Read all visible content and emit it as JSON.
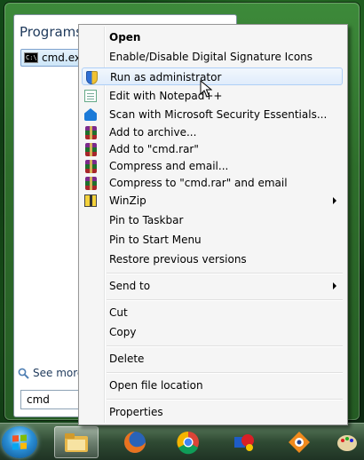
{
  "start_menu": {
    "programs_header": "Programs (",
    "result": {
      "label": "cmd.ex",
      "icon": "command-prompt-icon"
    },
    "see_more": "See more",
    "search_value": "cmd"
  },
  "context_menu": {
    "items": [
      {
        "label": "Open",
        "bold": true,
        "icon": ""
      },
      {
        "label": "Enable/Disable Digital Signature Icons",
        "icon": ""
      },
      {
        "label": "Run as administrator",
        "icon": "uac-shield-icon",
        "hover": true
      },
      {
        "label": "Edit with Notepad++",
        "icon": "notepad-plus-plus-icon"
      },
      {
        "label": "Scan with Microsoft Security Essentials...",
        "icon": "security-essentials-icon"
      },
      {
        "label": "Add to archive...",
        "icon": "winrar-icon"
      },
      {
        "label": "Add to \"cmd.rar\"",
        "icon": "winrar-icon"
      },
      {
        "label": "Compress and email...",
        "icon": "winrar-icon"
      },
      {
        "label": "Compress to \"cmd.rar\" and email",
        "icon": "winrar-icon"
      },
      {
        "label": "WinZip",
        "icon": "winzip-icon",
        "submenu": true
      },
      {
        "label": "Pin to Taskbar",
        "icon": ""
      },
      {
        "label": "Pin to Start Menu",
        "icon": ""
      },
      {
        "label": "Restore previous versions",
        "icon": ""
      },
      {
        "label": "Send to",
        "icon": "",
        "submenu": true
      },
      {
        "label": "Cut",
        "icon": ""
      },
      {
        "label": "Copy",
        "icon": ""
      },
      {
        "label": "Delete",
        "icon": ""
      },
      {
        "label": "Open file location",
        "icon": ""
      },
      {
        "label": "Properties",
        "icon": ""
      }
    ]
  },
  "taskbar": {
    "start_button": "windows-start-orb",
    "pinned": [
      "file-explorer-icon",
      "firefox-icon",
      "chrome-icon",
      "paint-app-icon",
      "picasa-icon",
      "paint-palette-icon"
    ]
  }
}
